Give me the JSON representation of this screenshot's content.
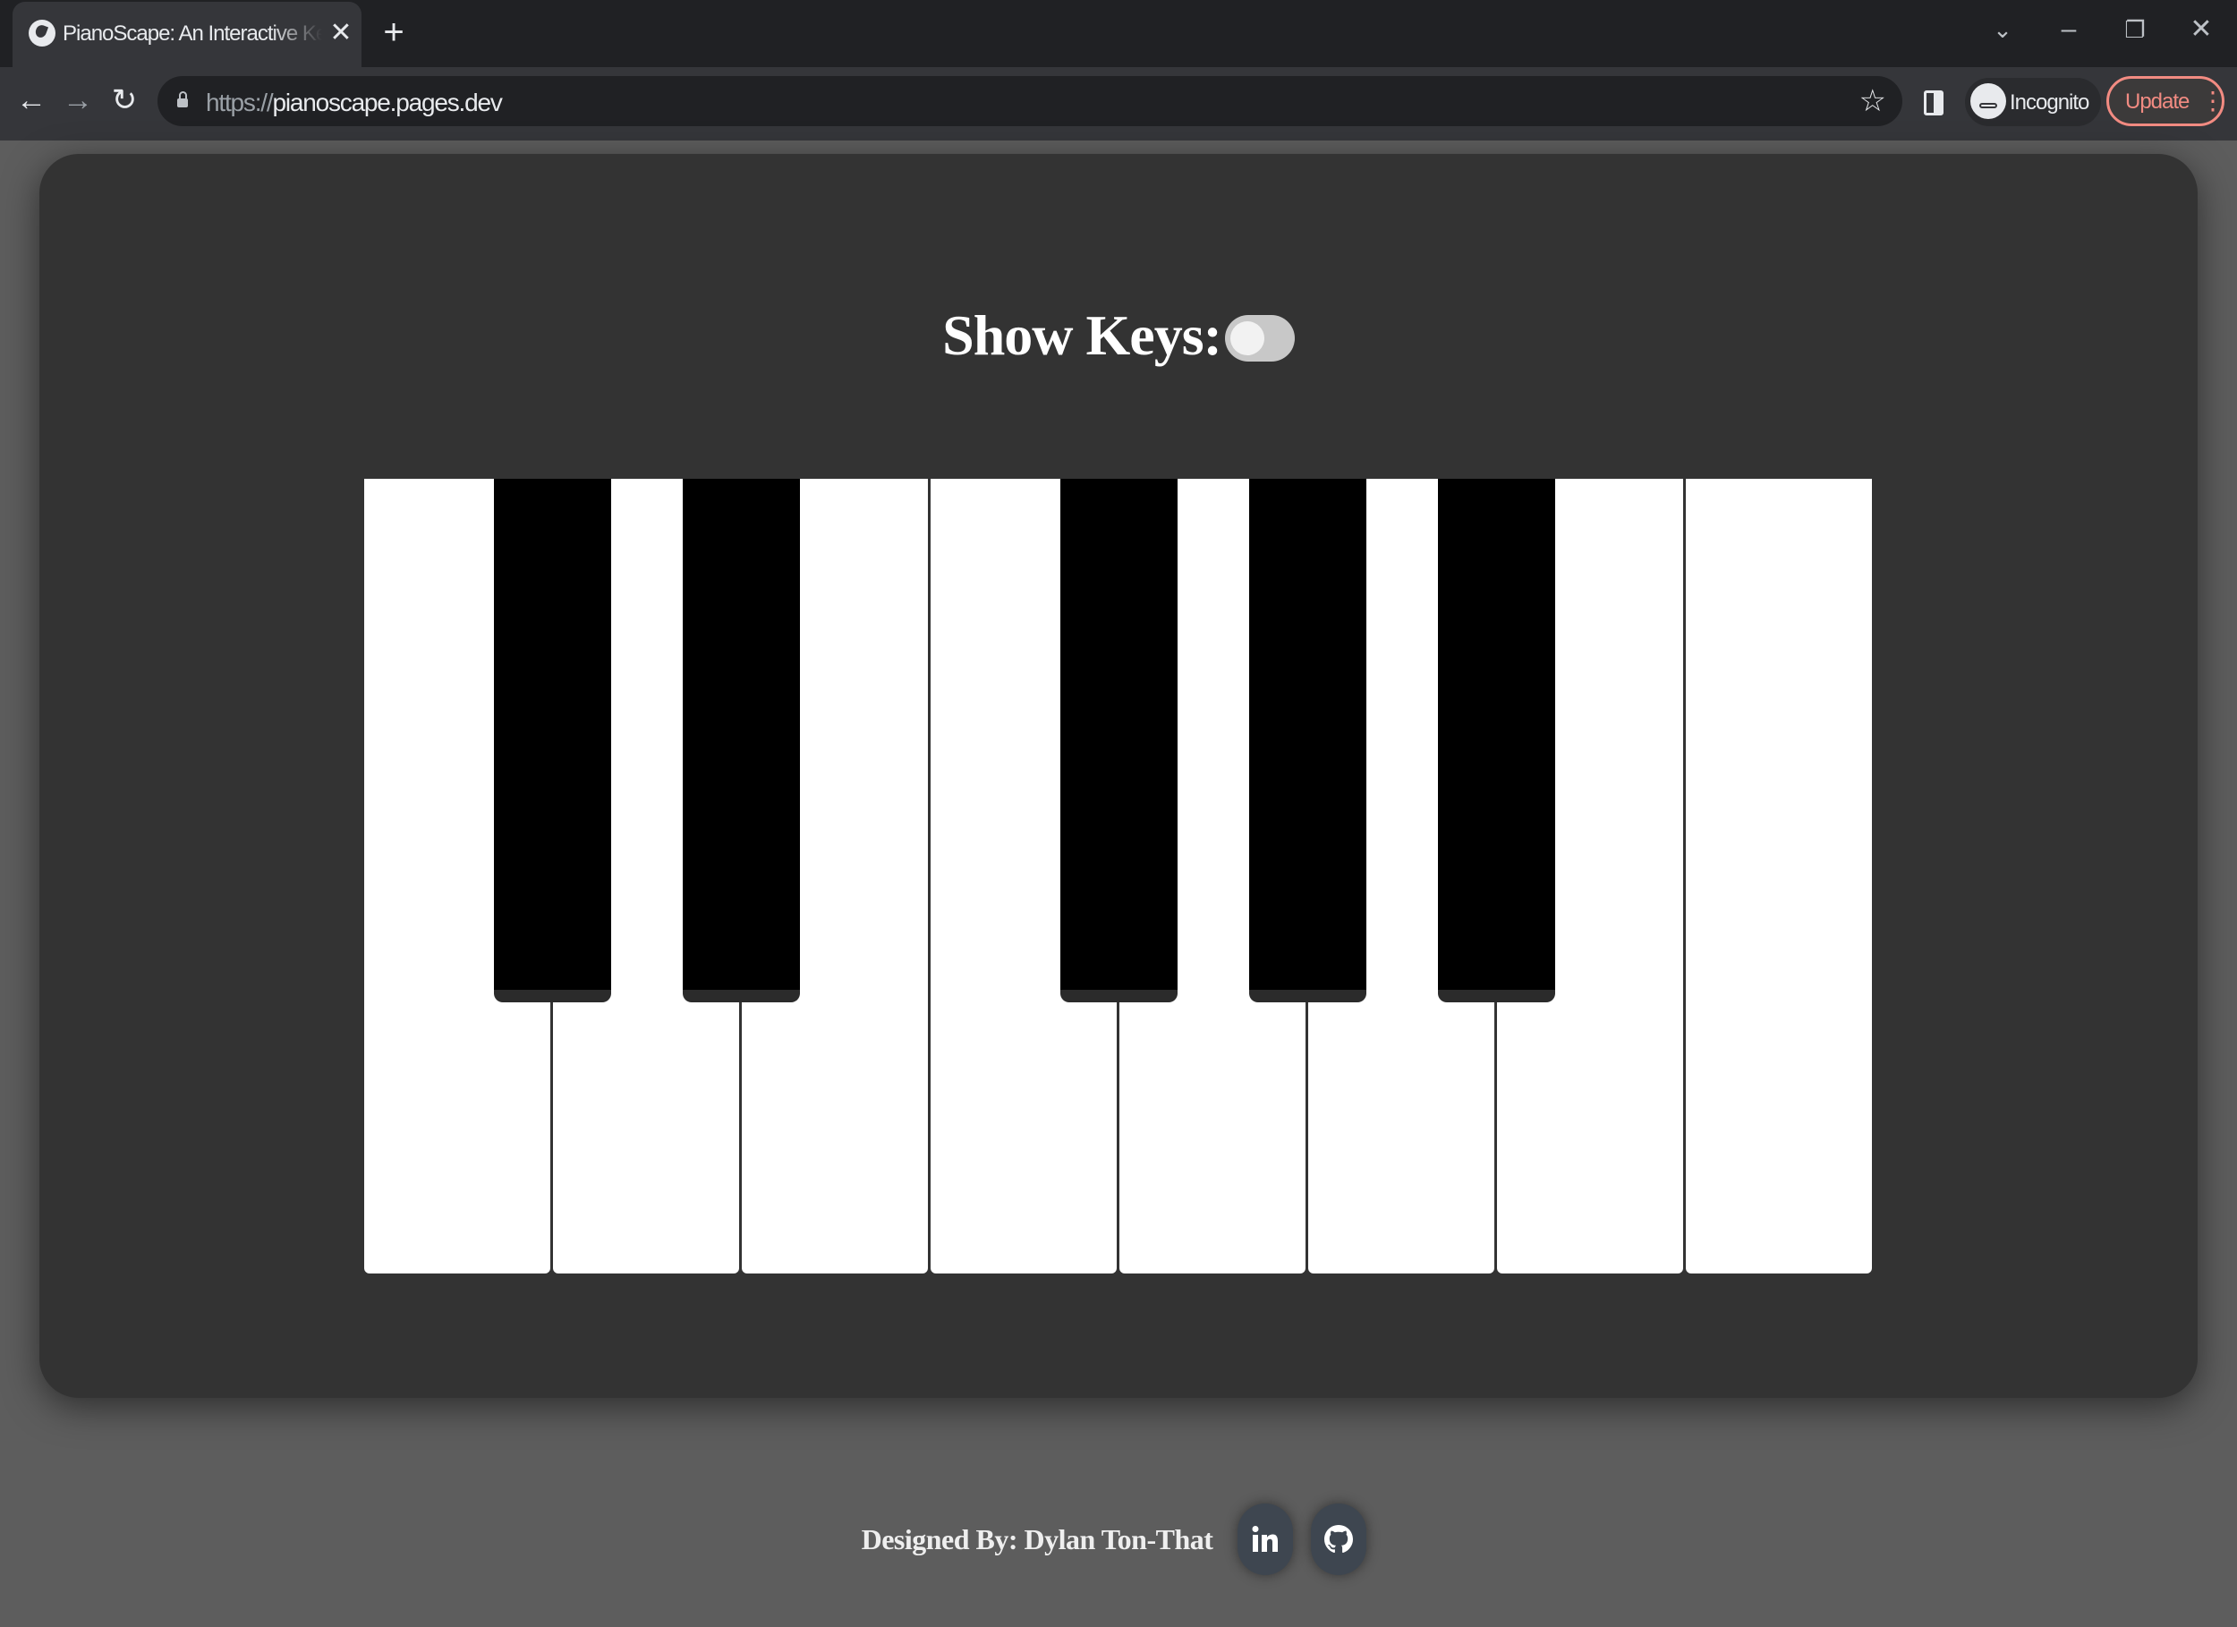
{
  "browser": {
    "tab_title": "PianoScape: An Interactive Keyboard",
    "tab_close": "✕",
    "new_tab": "+",
    "url_scheme": "https://",
    "url_host": "pianoscape.pages.dev",
    "incognito_label": "Incognito",
    "update_label": "Update",
    "menu": "⋮",
    "window_controls": {
      "dropdown": "⌄",
      "minimize": "–",
      "restore": "❐",
      "close": "✕"
    },
    "nav": {
      "back": "←",
      "forward": "→",
      "reload": "↻"
    },
    "bookmark": "☆"
  },
  "app": {
    "show_keys_label": "Show Keys:",
    "show_keys_enabled": false,
    "piano": {
      "white_keys": 8,
      "black_keys_after_white_index": [
        0,
        1,
        3,
        4,
        5
      ]
    }
  },
  "footer": {
    "credit": "Designed By: Dylan Ton-That",
    "links": [
      {
        "name": "linkedin",
        "icon": "linkedin-icon"
      },
      {
        "name": "github",
        "icon": "github-icon"
      }
    ]
  }
}
